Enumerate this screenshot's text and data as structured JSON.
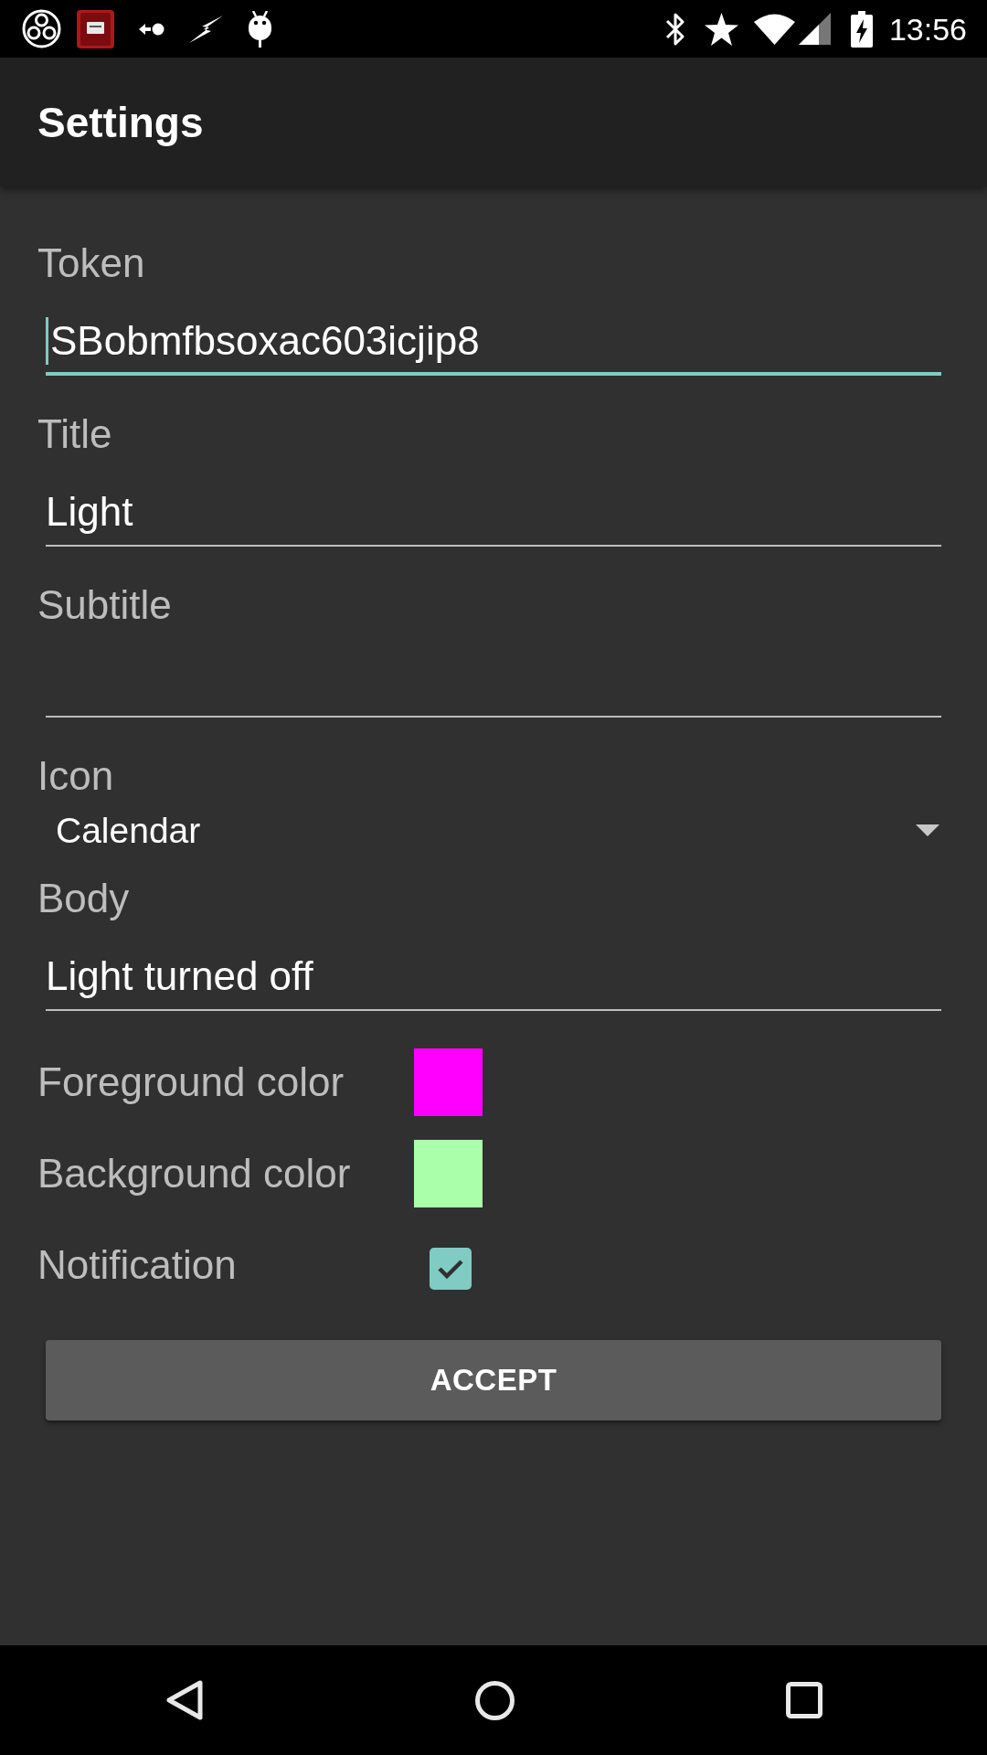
{
  "status_bar": {
    "time": "13:56"
  },
  "app_bar": {
    "title": "Settings"
  },
  "form": {
    "fields": [
      {
        "kind": "text",
        "label": "Token",
        "value": "SBobmfbsoxac603icjip8",
        "focused": true
      },
      {
        "kind": "text",
        "label": "Title",
        "value": "Light",
        "focused": false
      },
      {
        "kind": "text",
        "label": "Subtitle",
        "focused": false
      },
      {
        "kind": "dropdown",
        "label": "Icon",
        "value": "Calendar"
      },
      {
        "kind": "text",
        "label": "Body",
        "value": "Light turned off",
        "focused": false
      },
      {
        "kind": "color",
        "label": "Foreground color",
        "color": "#ff00ff"
      },
      {
        "kind": "color",
        "label": "Background color",
        "color": "#aaffaa"
      },
      {
        "kind": "checkbox",
        "label": "Notification",
        "checked": true
      }
    ]
  },
  "accept_button": "ACCEPT"
}
